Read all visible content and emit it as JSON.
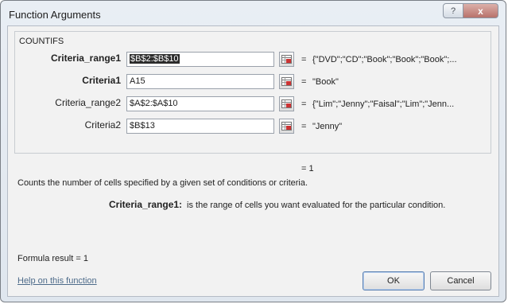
{
  "window": {
    "title": "Function Arguments",
    "help_glyph": "?",
    "close_glyph": "x"
  },
  "function_name": "COUNTIFS",
  "arguments": [
    {
      "label": "Criteria_range1",
      "value": "$B$2:$B$10",
      "result": "{\"DVD\";\"CD\";\"Book\";\"Book\";\"Book\";...",
      "bold": true,
      "selected": true
    },
    {
      "label": "Criteria1",
      "value": "A15",
      "result": "\"Book\"",
      "bold": true,
      "selected": false
    },
    {
      "label": "Criteria_range2",
      "value": "$A$2:$A$10",
      "result": "{\"Lim\";\"Jenny\";\"Faisal\";\"Lim\";\"Jenn...",
      "bold": false,
      "selected": false
    },
    {
      "label": "Criteria2",
      "value": "$B$13",
      "result": "\"Jenny\"",
      "bold": false,
      "selected": false
    }
  ],
  "equals_sign": "=",
  "function_result": "= 1",
  "description": "Counts the number of cells specified by a given set of conditions or criteria.",
  "argument_help": {
    "name": "Criteria_range1:",
    "text": "is the range of cells you want evaluated for the particular condition."
  },
  "formula_result": "Formula result =  1",
  "help_link": "Help on this function",
  "buttons": {
    "ok": "OK",
    "cancel": "Cancel"
  },
  "icons": {
    "ref": "collapse-dialog-icon",
    "help": "help-icon",
    "close": "close-icon"
  }
}
